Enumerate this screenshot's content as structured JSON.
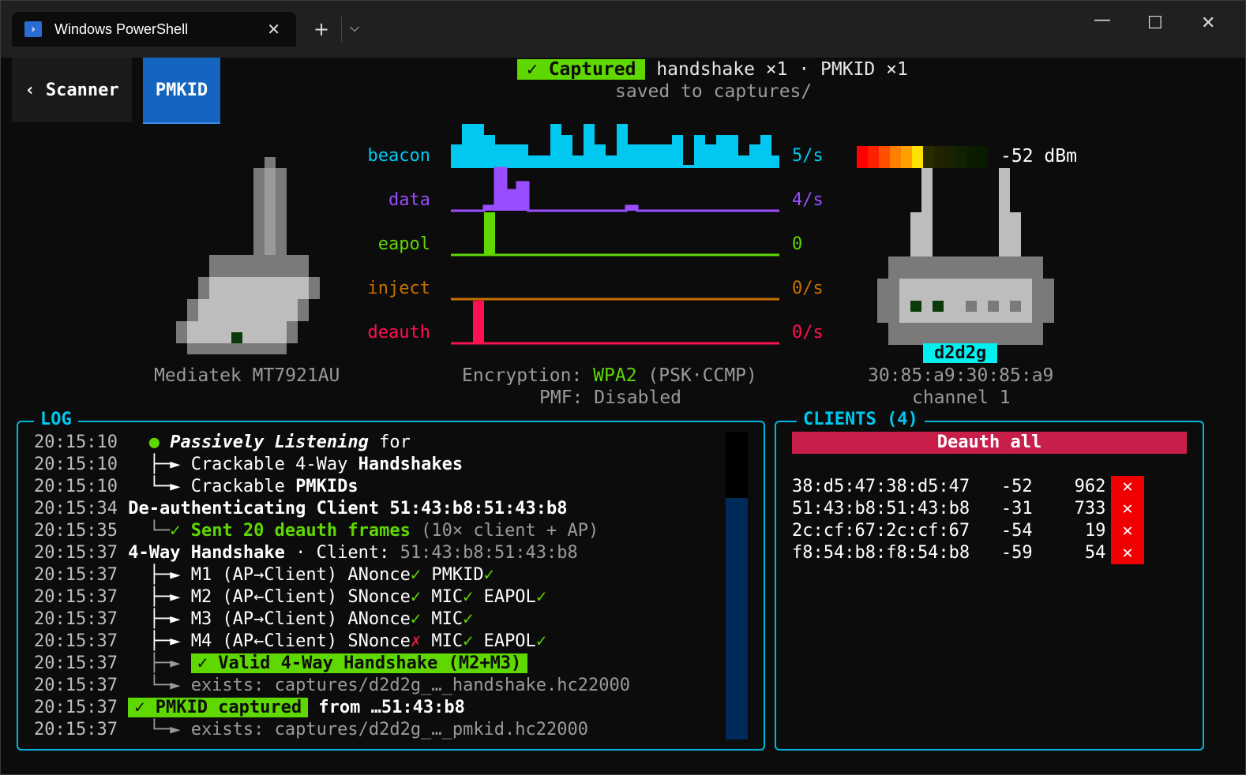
{
  "window": {
    "tab_title": "Windows PowerShell",
    "tab_icon": "powershell-icon",
    "controls": [
      "minimize-icon",
      "maximize-icon",
      "close-icon"
    ]
  },
  "nav": {
    "back_label": "‹ Scanner",
    "active_tab": "PMKID"
  },
  "status": {
    "badge": "✓ Captured",
    "summary": " handshake ×1 · PMKID ×1",
    "saved": "saved to captures/"
  },
  "adapter": {
    "name": "Mediatek MT7921AU"
  },
  "graphs": {
    "beacon": {
      "label": "beacon",
      "value": "5/s",
      "color": "#00c8f0"
    },
    "data": {
      "label": "data",
      "value": "4/s",
      "color": "#9a4dff"
    },
    "eapol": {
      "label": "eapol",
      "value": "0",
      "color": "#5fd700"
    },
    "inject": {
      "label": "inject",
      "value": "0/s",
      "color": "#c87000"
    },
    "deauth": {
      "label": "deauth",
      "value": "0/s",
      "color": "#ff1050"
    }
  },
  "encryption": {
    "label": "Encryption: ",
    "value": "WPA2",
    "detail": " (PSK·CCMP)",
    "pmf": "PMF: Disabled"
  },
  "ap": {
    "signal": "-52 dBm",
    "ssid": "d2d2g",
    "bssid": "30:85:a9:30:85:a9",
    "channel": "channel 1"
  },
  "log": {
    "title": "LOG",
    "lines": [
      {
        "ts": "20:15:10",
        "a": " ● ",
        "b": "Passively Listening",
        "c": " for"
      },
      {
        "ts": "20:15:10",
        "a": " ├─► Crackable 4-Way ",
        "b": "Handshakes"
      },
      {
        "ts": "20:15:10",
        "a": " └─► Crackable ",
        "b": "PMKIDs"
      },
      {
        "ts": "20:15:34",
        "a": "De-authenticating Client 51:43:b8:51:43:b8"
      },
      {
        "ts": "20:15:35",
        "a": " └─",
        "b": "✓ Sent 20 deauth frames",
        "c": " (10× client + AP)"
      },
      {
        "ts": "20:15:37",
        "a": "4-Way Handshake",
        "b": " · Client: ",
        "c": "51:43:b8:51:43:b8"
      },
      {
        "ts": "20:15:37",
        "a": " ├─► M1 (AP→Client) ANonce",
        "b": "✓",
        "c": " PMKID",
        "d": "✓"
      },
      {
        "ts": "20:15:37",
        "a": " ├─► M2 (AP←Client) SNonce",
        "b": "✓",
        "c": " MIC",
        "d": "✓",
        "e": " EAPOL",
        "f": "✓"
      },
      {
        "ts": "20:15:37",
        "a": " ├─► M3 (AP→Client) ANonce",
        "b": "✓",
        "c": " MIC",
        "d": "✓"
      },
      {
        "ts": "20:15:37",
        "a": " ├─► M4 (AP←Client) SNonce",
        "b": "✗",
        "c": " MIC",
        "d": "✓",
        "e": " EAPOL",
        "f": "✓"
      },
      {
        "ts": "20:15:37",
        "a": " ├─► ",
        "b": "✓ Valid 4-Way Handshake (M2+M3)"
      },
      {
        "ts": "20:15:37",
        "a": " └─► exists: captures/d2d2g_…_handshake.hc22000"
      },
      {
        "ts": "20:15:37",
        "a": "✓ PMKID captured",
        "b": " from …51:43:b8"
      },
      {
        "ts": "20:15:37",
        "a": " └─► exists: captures/d2d2g_…_pmkid.hc22000"
      }
    ]
  },
  "clients": {
    "title": "CLIENTS (4)",
    "deauth_all": "Deauth all",
    "rows": [
      {
        "mac": "38:d5:47:38:d5:47",
        "rssi": "-52",
        "count": "962",
        "kill": "✕"
      },
      {
        "mac": "51:43:b8:51:43:b8",
        "rssi": "-31",
        "count": "733",
        "kill": "✕"
      },
      {
        "mac": "2c:cf:67:2c:cf:67",
        "rssi": "-54",
        "count": "19",
        "kill": "✕"
      },
      {
        "mac": "f8:54:b8:f8:54:b8",
        "rssi": "-59",
        "count": "54",
        "kill": "✕"
      }
    ]
  }
}
